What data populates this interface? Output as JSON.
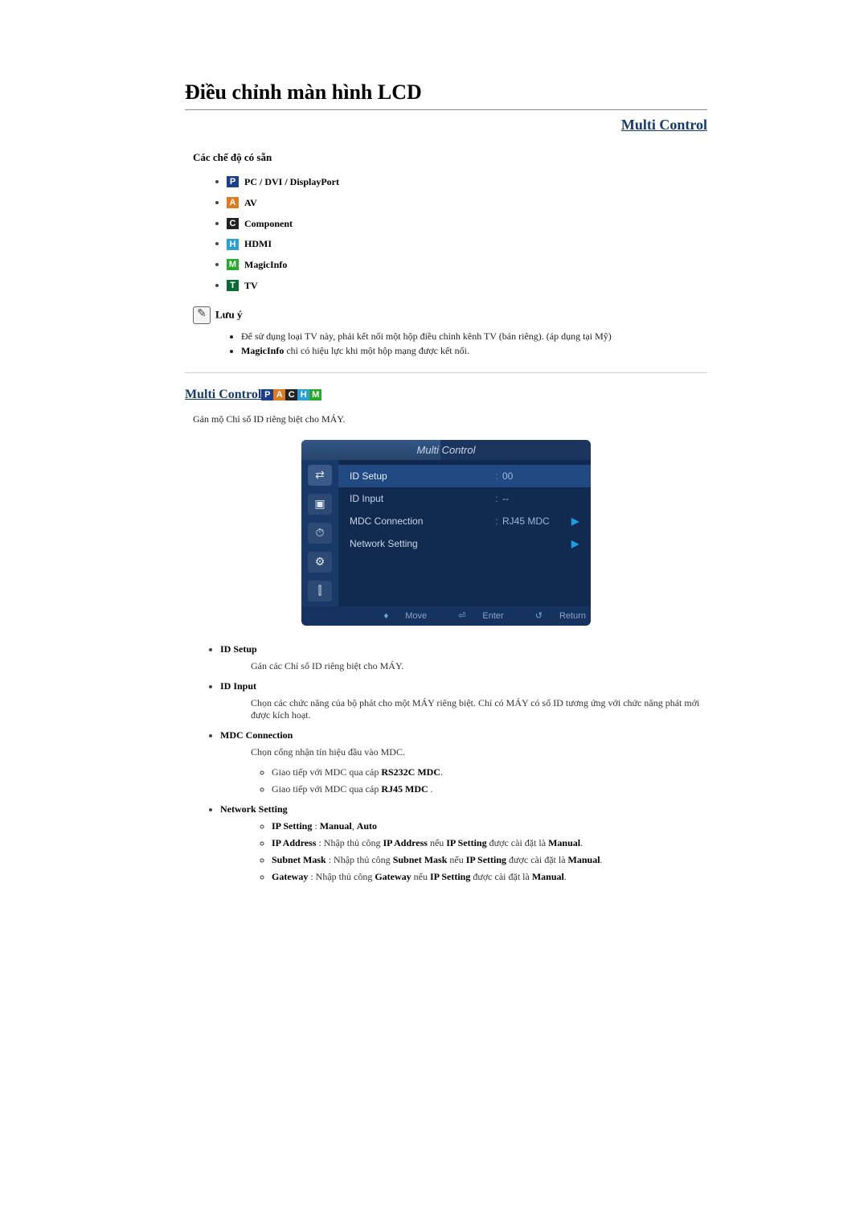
{
  "title": "Điều chỉnh màn hình LCD",
  "top_link": "Multi Control",
  "modes_heading": "Các chế độ có sẵn",
  "modes": [
    {
      "icon_letter": "P",
      "icon_class": "ic-P",
      "icon_name": "mode-pc-icon",
      "label": "PC / DVI / DisplayPort"
    },
    {
      "icon_letter": "A",
      "icon_class": "ic-A",
      "icon_name": "mode-av-icon",
      "label": "AV"
    },
    {
      "icon_letter": "C",
      "icon_class": "ic-C",
      "icon_name": "mode-component-icon",
      "label": "Component"
    },
    {
      "icon_letter": "H",
      "icon_class": "ic-H",
      "icon_name": "mode-hdmi-icon",
      "label": "HDMI"
    },
    {
      "icon_letter": "M",
      "icon_class": "ic-M",
      "icon_name": "mode-magicinfo-icon",
      "label": "MagicInfo"
    },
    {
      "icon_letter": "T",
      "icon_class": "ic-T",
      "icon_name": "mode-tv-icon",
      "label": "TV"
    }
  ],
  "note_label": "Lưu ý",
  "notes": [
    "Để sử dụng loại TV này, phải kết nối một hộp điều chỉnh kênh TV (bán riêng). (áp dụng tại Mỹ)",
    "MagicInfo chỉ có hiệu lực khi một hộp mạng được kết nối."
  ],
  "notes_bold_word": "MagicInfo",
  "mc_heading": "Multi Control",
  "mc_icons": [
    {
      "letter": "P",
      "cls": "ic-P",
      "name": "mode-pc-icon"
    },
    {
      "letter": "A",
      "cls": "ic-A",
      "name": "mode-av-icon"
    },
    {
      "letter": "C",
      "cls": "ic-C",
      "name": "mode-component-icon"
    },
    {
      "letter": "H",
      "cls": "ic-H",
      "name": "mode-hdmi-icon"
    },
    {
      "letter": "M",
      "cls": "ic-M",
      "name": "mode-magicinfo-icon"
    }
  ],
  "mc_intro": "Gán mộ Chỉ số ID riêng biệt cho MÁY.",
  "osd": {
    "title": "Multi Control",
    "rows": [
      {
        "label": "ID Setup",
        "colon": ":",
        "value": "00",
        "arrow": "",
        "selected": true
      },
      {
        "label": "ID Input",
        "colon": ":",
        "value": "--",
        "arrow": "",
        "selected": false
      },
      {
        "label": "MDC Connection",
        "colon": ":",
        "value": "RJ45 MDC",
        "arrow": "▶",
        "selected": false
      },
      {
        "label": "Network Setting",
        "colon": "",
        "value": "",
        "arrow": "▶",
        "selected": false
      }
    ],
    "side_icons": [
      "⇄",
      "▣",
      "⏱",
      "⚙",
      "⫿"
    ],
    "footer": {
      "move": "Move",
      "enter": "Enter",
      "return": "Return"
    }
  },
  "spec": {
    "id_setup": {
      "label": "ID Setup",
      "desc": "Gán các Chỉ số ID riêng biệt cho MÁY."
    },
    "id_input": {
      "label": "ID Input",
      "desc": "Chọn các chức năng của bộ phát cho một MÁY riêng biệt. Chỉ có MÁY có số ID tương ứng với chức năng phát mới được kích hoạt."
    },
    "mdc_conn": {
      "label": "MDC Connection",
      "desc": "Chọn cổng nhận tín hiệu đầu vào MDC.",
      "items": [
        {
          "pre": "Giao tiếp với MDC qua cáp ",
          "bold": "RS232C MDC",
          "post": "."
        },
        {
          "pre": "Giao tiếp với MDC qua cáp ",
          "bold": "RJ45 MDC",
          "post": " ."
        }
      ]
    },
    "net": {
      "label": "Network Setting",
      "items": [
        {
          "bold1": "IP Setting",
          "mid": " : ",
          "bold2": "Manual",
          "sep": ", ",
          "bold3": "Auto",
          "post": ""
        },
        {
          "bold1": "IP Address",
          "mid": " : Nhập thủ công ",
          "bold2": "IP Address",
          "sep": " nếu ",
          "bold3": "IP Setting",
          "post": " được cài đặt là ",
          "bold4": "Manual",
          "end": "."
        },
        {
          "bold1": "Subnet Mask",
          "mid": " : Nhập thủ công ",
          "bold2": "Subnet Mask",
          "sep": " nếu ",
          "bold3": "IP Setting",
          "post": " được cài đặt là ",
          "bold4": "Manual",
          "end": "."
        },
        {
          "bold1": "Gateway",
          "mid": " : Nhập thủ công ",
          "bold2": "Gateway",
          "sep": " nếu ",
          "bold3": "IP Setting",
          "post": " được cài đặt là ",
          "bold4": "Manual",
          "end": "."
        }
      ]
    }
  }
}
